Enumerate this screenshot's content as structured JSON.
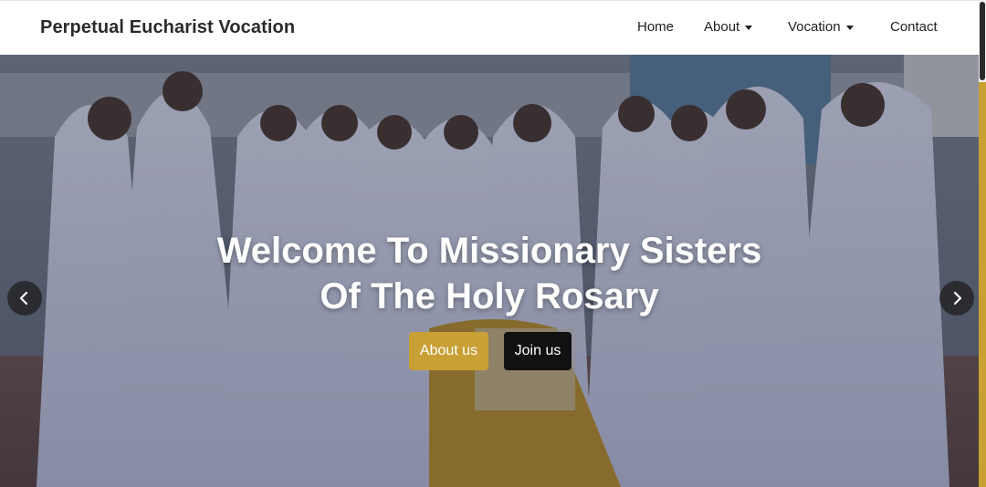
{
  "navbar": {
    "brand": "Perpetual Eucharist Vocation",
    "links": [
      {
        "label": "Home",
        "dropdown": false
      },
      {
        "label": "About",
        "dropdown": true
      },
      {
        "label": "Vocation",
        "dropdown": true
      },
      {
        "label": "Contact",
        "dropdown": false
      }
    ]
  },
  "hero": {
    "title_line1": "Welcome To Missionary Sisters",
    "title_line2": "Of The Holy Rosary",
    "buttons": {
      "about_label": "About us",
      "join_label": "Join us"
    },
    "prev_icon": "chevron-left-icon",
    "next_icon": "chevron-right-icon"
  },
  "colors": {
    "accent_gold": "#c9a036",
    "join_button": "#111111",
    "nav_text": "#1e1e1e"
  }
}
